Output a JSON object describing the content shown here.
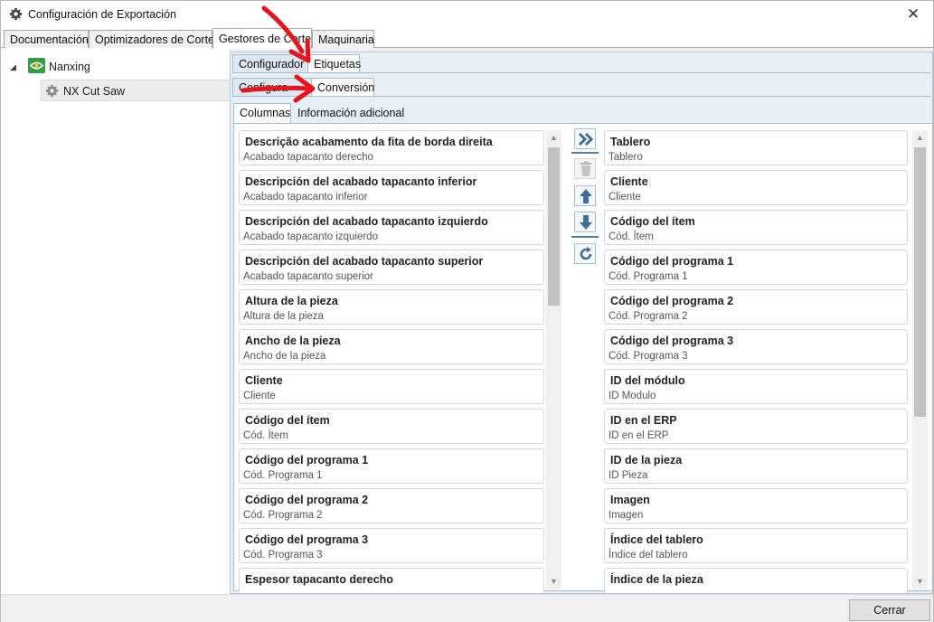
{
  "window": {
    "title": "Configuración de Exportación",
    "close_glyph": "✕",
    "icon": "gear-icon"
  },
  "main_tabs": [
    "Documentación",
    "Optimizadores de Corte",
    "Gestores de Corte",
    "Maquinaria"
  ],
  "tree": {
    "root": "Nanxing",
    "child": "NX Cut Saw"
  },
  "config_tabs": [
    "Configurador",
    "Etiquetas"
  ],
  "label_tabs": [
    "Configura",
    "Conversión"
  ],
  "column_tabs": [
    "Columnas",
    "Información adicional"
  ],
  "available_columns": [
    {
      "title": "Descrição acabamento da fita de borda direita",
      "sub": "Acabado tapacanto derecho"
    },
    {
      "title": "Descripción del acabado tapacanto inferior",
      "sub": "Acabado tapacanto inferior"
    },
    {
      "title": "Descripción del acabado tapacanto izquierdo",
      "sub": "Acabado tapacanto izquierdo"
    },
    {
      "title": "Descripción del acabado tapacanto superior",
      "sub": "Acabado tapacanto superior"
    },
    {
      "title": "Altura de la pieza",
      "sub": "Altura de la pieza"
    },
    {
      "title": "Ancho de la pieza",
      "sub": "Ancho de la pieza"
    },
    {
      "title": "Cliente",
      "sub": "Cliente"
    },
    {
      "title": "Código del ítem",
      "sub": "Cód. Ítem"
    },
    {
      "title": "Código del programa 1",
      "sub": "Cód. Programa 1"
    },
    {
      "title": "Código del programa 2",
      "sub": "Cód. Programa 2"
    },
    {
      "title": "Código del programa 3",
      "sub": "Cód. Programa 3"
    },
    {
      "title": "Espesor tapacanto derecho",
      "sub": ""
    }
  ],
  "selected_columns": [
    {
      "title": "Tablero",
      "sub": "Tablero"
    },
    {
      "title": "Cliente",
      "sub": "Cliente"
    },
    {
      "title": "Código del ítem",
      "sub": "Cód. Ítem"
    },
    {
      "title": "Código del programa 1",
      "sub": "Cód. Programa 1"
    },
    {
      "title": "Código del programa 2",
      "sub": "Cód. Programa 2"
    },
    {
      "title": "Código del programa 3",
      "sub": "Cód. Programa 3"
    },
    {
      "title": "ID del módulo",
      "sub": "ID Modulo"
    },
    {
      "title": "ID en el ERP",
      "sub": "ID en el ERP"
    },
    {
      "title": "ID de la pieza",
      "sub": "ID Pieza"
    },
    {
      "title": "Imagen",
      "sub": "Imagen"
    },
    {
      "title": "Índice del tablero",
      "sub": "Índice del tablero"
    },
    {
      "title": "Índice de la pieza",
      "sub": ""
    }
  ],
  "footer": {
    "close_label": "Cerrar"
  },
  "colors": {
    "accent_blue": "#3f6f98",
    "annotation_red": "#e8141b",
    "tab_area": "#e7eff7"
  }
}
